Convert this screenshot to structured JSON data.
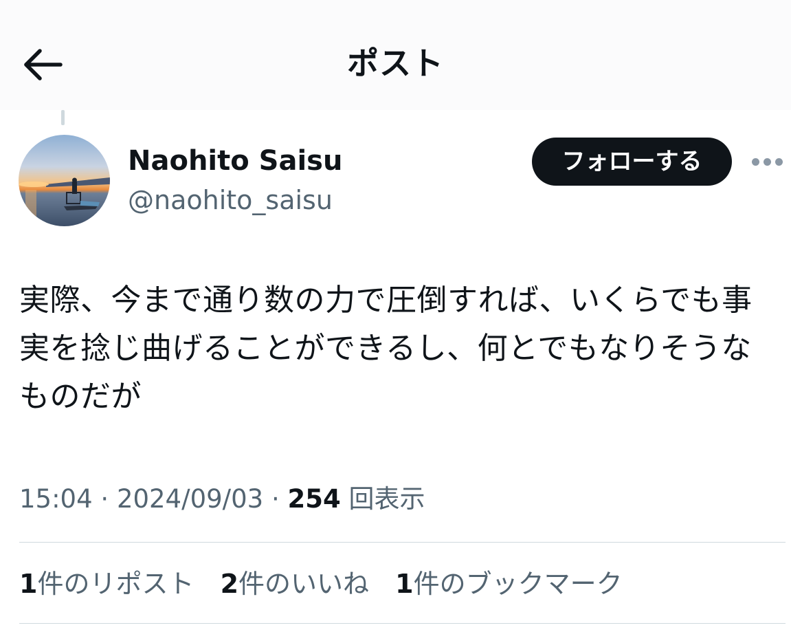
{
  "header": {
    "title": "ポスト",
    "back_icon": "arrow-left-icon"
  },
  "author": {
    "display_name": "Naohito Saisu",
    "handle": "@naohito_saisu",
    "follow_label": "フォローする",
    "more_icon": "more-horizontal-icon"
  },
  "post": {
    "text": "実際、今まで通り数の力で圧倒すれば、いくらでも事実を捻じ曲げることができるし、何とでもなりそうなものだが",
    "time": "15:04",
    "date": "2024/09/03",
    "views_count": "254",
    "views_label": "回表示"
  },
  "stats": [
    {
      "count": "1",
      "label": "件のリポスト"
    },
    {
      "count": "2",
      "label": "件のいいね"
    },
    {
      "count": "1",
      "label": "件のブックマーク"
    }
  ],
  "colors": {
    "text_primary": "#0f1419",
    "text_secondary": "#536471",
    "divider": "#cfd9de",
    "follow_bg": "#0f1419"
  }
}
